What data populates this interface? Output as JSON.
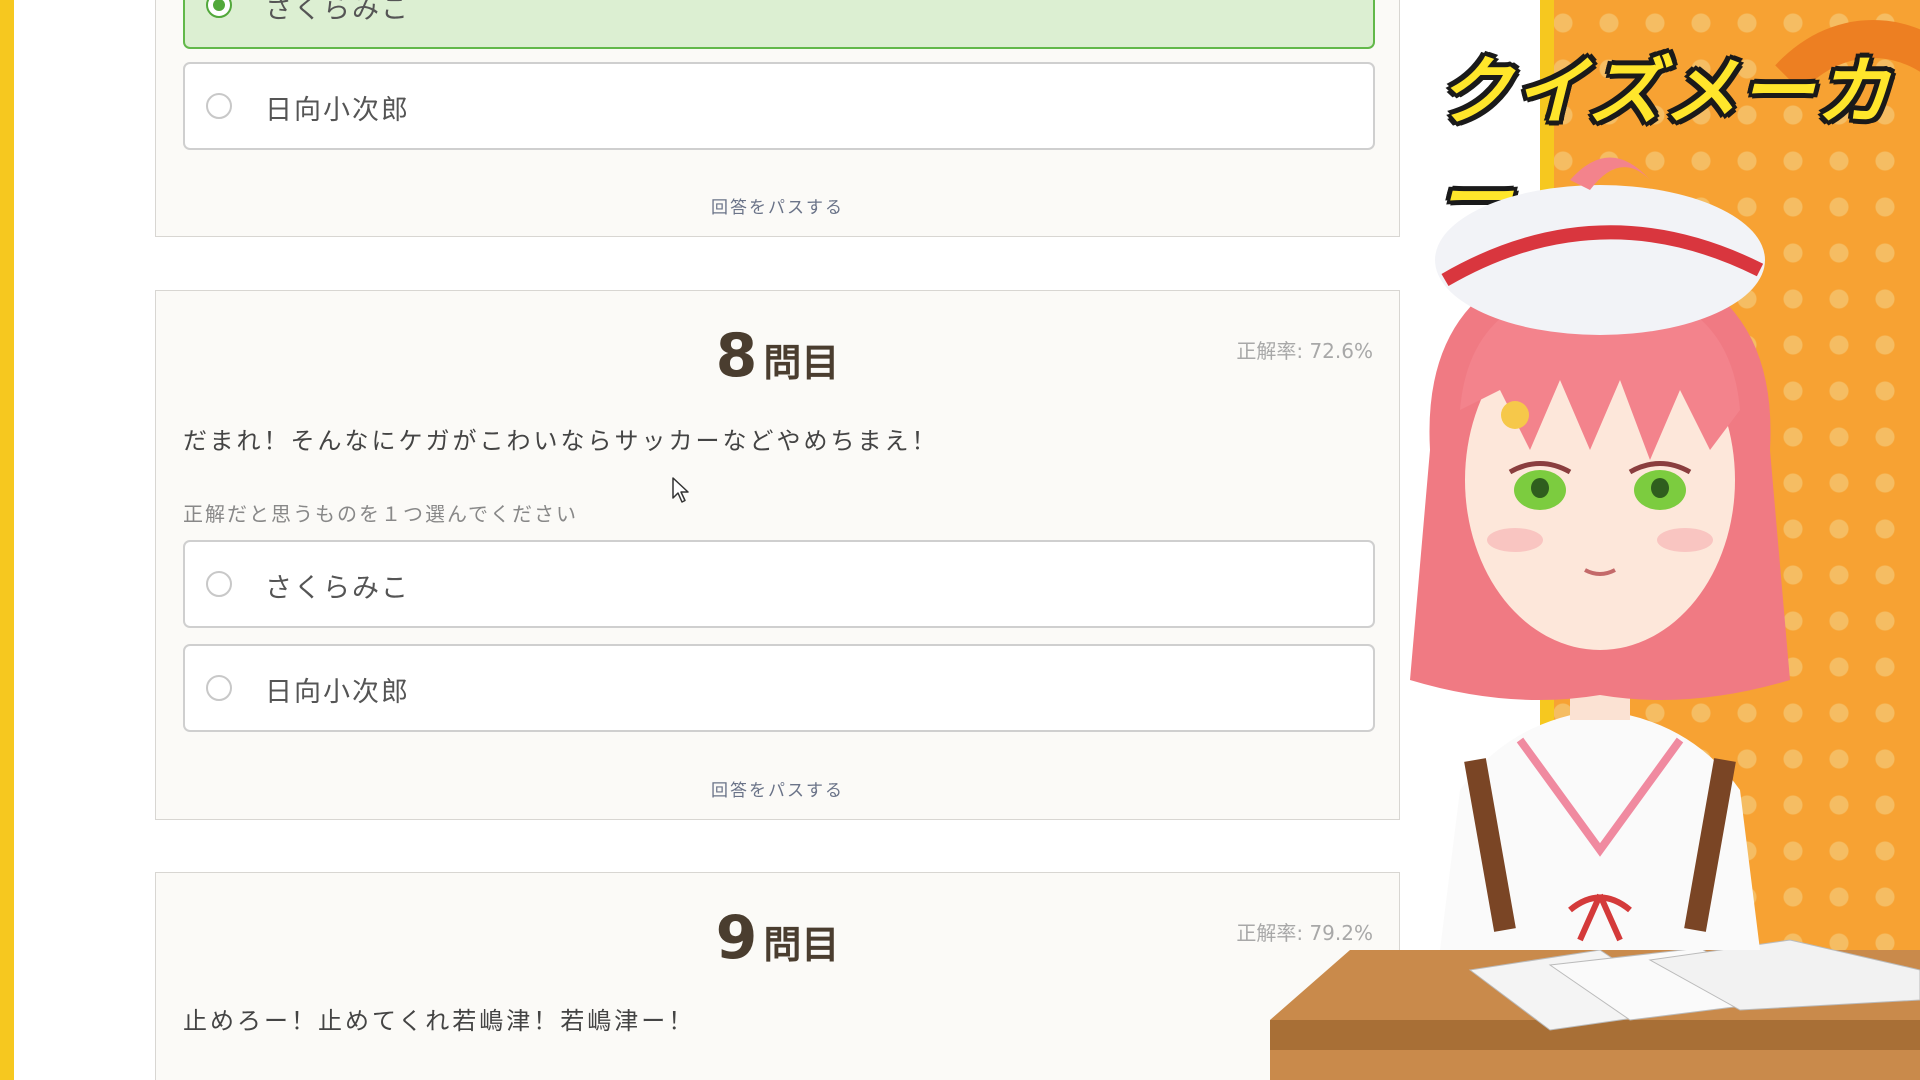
{
  "overlay": {
    "title": "クイズメーカー"
  },
  "previous_question": {
    "options": [
      {
        "label": "さくらみこ",
        "selected": true
      },
      {
        "label": "日向小次郎",
        "selected": false
      }
    ],
    "pass_label": "回答をパスする"
  },
  "question_8": {
    "number": "8",
    "suffix": "問目",
    "correct_rate": "正解率: 72.6%",
    "text": "だまれ！そんなにケガがこわいならサッカーなどやめちまえ！",
    "instruction": "正解だと思うものを１つ選んでください",
    "options": [
      {
        "label": "さくらみこ",
        "selected": false
      },
      {
        "label": "日向小次郎",
        "selected": false
      }
    ],
    "pass_label": "回答をパスする"
  },
  "question_9": {
    "number": "9",
    "suffix": "問目",
    "correct_rate": "正解率: 79.2%",
    "text": "止めろー！止めてくれ若嶋津！若嶋津ー！"
  },
  "colors": {
    "accent_yellow": "#f6c81f",
    "selected_green": "#62b84a",
    "selected_bg": "#dcefd2",
    "panel_orange": "#f7a233"
  },
  "icons": [
    "radio-icon",
    "cursor-icon"
  ]
}
